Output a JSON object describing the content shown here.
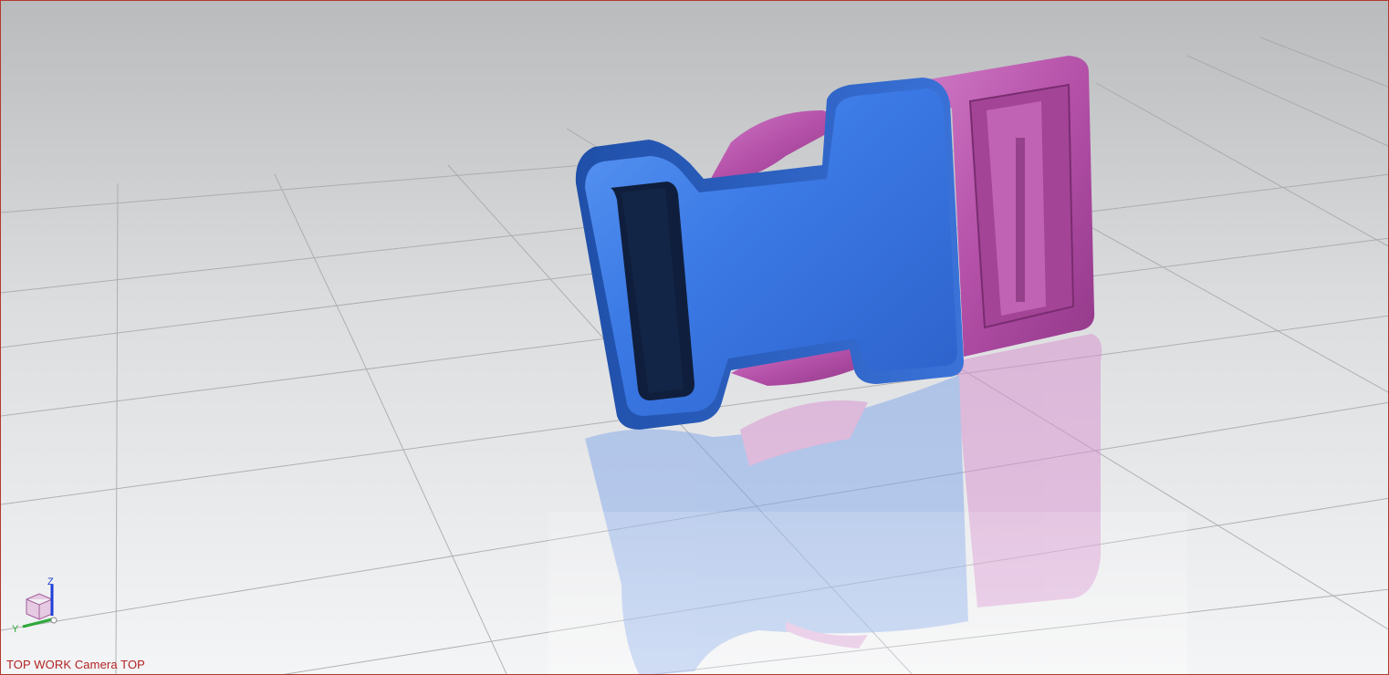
{
  "viewport": {
    "view_label": "TOP WORK Camera TOP",
    "border_color": "#b23a2e"
  },
  "scene": {
    "background_top": "#b9bbbd",
    "background_bottom": "#f2f3f4",
    "grid_color": "#a5a7aa",
    "model": {
      "parts": [
        {
          "name": "female-buckle",
          "color": "#3c7ae6"
        },
        {
          "name": "male-buckle",
          "color": "#b450a8"
        }
      ],
      "reflection": true
    }
  },
  "triad": {
    "z_label": "Z",
    "y_label": "Y",
    "z_color": "#1f3fd8",
    "y_color": "#2ea83a"
  }
}
